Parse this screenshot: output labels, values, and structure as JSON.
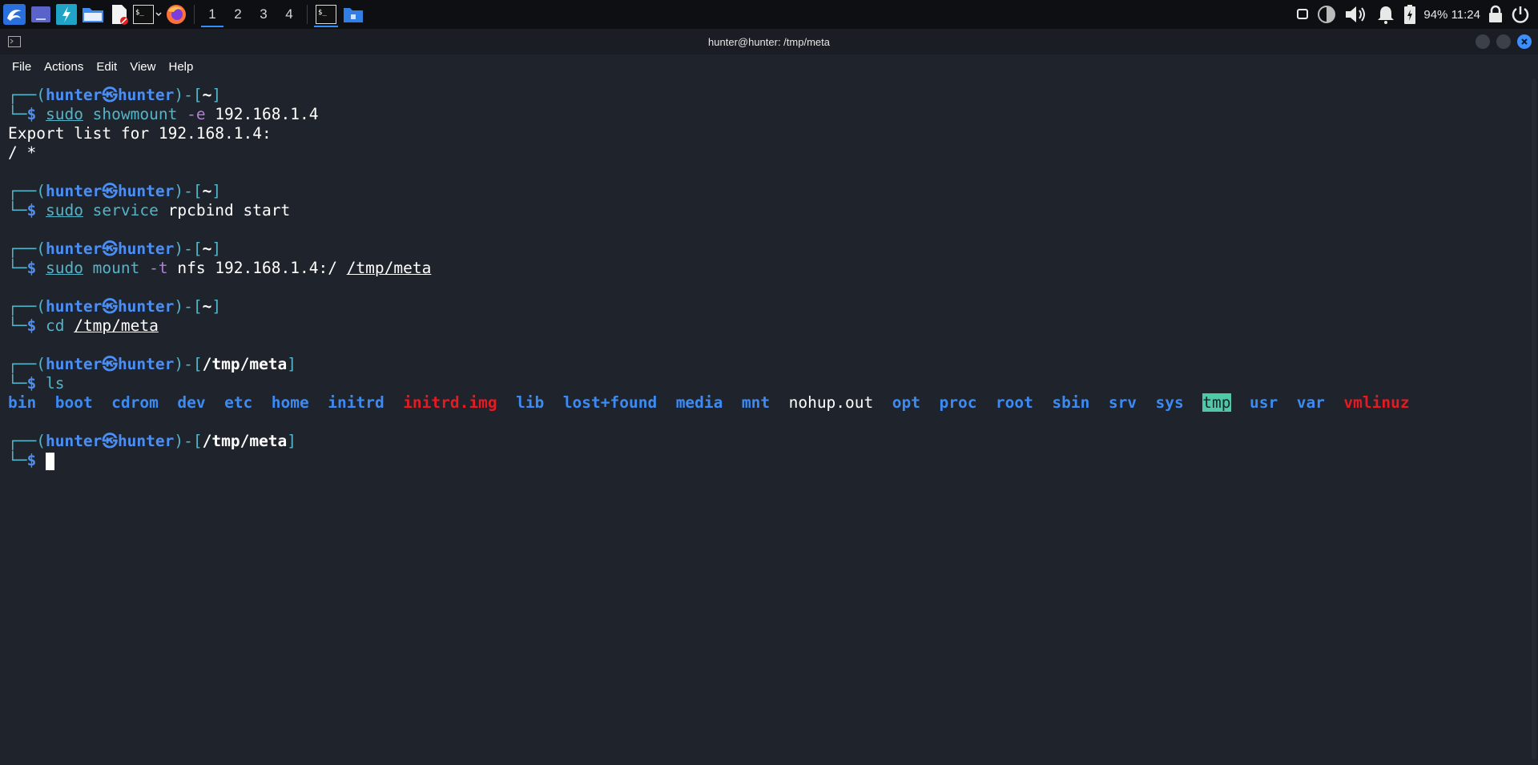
{
  "taskbar": {
    "workspaces": [
      "1",
      "2",
      "3",
      "4"
    ],
    "active_workspace": "1",
    "battery": "94%",
    "time": "11:24",
    "icons": [
      "kali-menu-icon",
      "desktop-icon",
      "settings-icon",
      "file-manager-icon",
      "text-editor-icon",
      "terminal-icon",
      "firefox-icon"
    ]
  },
  "window": {
    "title": "hunter@hunter: /tmp/meta",
    "menu": [
      "File",
      "Actions",
      "Edit",
      "View",
      "Help"
    ]
  },
  "terminal": {
    "user": "hunter",
    "host": "hunter",
    "skull": "㉿",
    "blocks": [
      {
        "path": "~",
        "cmd": "sudo",
        "args": [
          {
            "t": " showmount ",
            "c": "g"
          },
          {
            "t": "-e",
            "c": "opt"
          },
          {
            "t": " 192.168.1.4",
            "c": "plain"
          }
        ]
      },
      {
        "path": "~",
        "cmd": "sudo",
        "args": [
          {
            "t": " service ",
            "c": "g"
          },
          {
            "t": "rpcbind start",
            "c": "plain"
          }
        ]
      },
      {
        "path": "~",
        "cmd": "sudo",
        "args": [
          {
            "t": " mount ",
            "c": "g"
          },
          {
            "t": "-t",
            "c": "opt"
          },
          {
            "t": " nfs 192.168.1.4:/ ",
            "c": "plain"
          },
          {
            "t": "/tmp/meta",
            "c": "ul"
          }
        ]
      },
      {
        "path": "~",
        "cmd": "cd",
        "args": [
          {
            "t": " ",
            "c": "plain"
          },
          {
            "t": "/tmp/meta",
            "c": "ul"
          }
        ]
      },
      {
        "path": "/tmp/meta",
        "cmd": "ls",
        "args": []
      },
      {
        "path": "/tmp/meta",
        "cmd": "",
        "args": []
      }
    ],
    "showmount_output": [
      "Export list for 192.168.1.4:",
      "/ *"
    ],
    "ls_output": [
      {
        "name": "bin",
        "kind": "dir"
      },
      {
        "name": "boot",
        "kind": "dir"
      },
      {
        "name": "cdrom",
        "kind": "dir"
      },
      {
        "name": "dev",
        "kind": "dir"
      },
      {
        "name": "etc",
        "kind": "dir"
      },
      {
        "name": "home",
        "kind": "dir"
      },
      {
        "name": "initrd",
        "kind": "dir"
      },
      {
        "name": "initrd.img",
        "kind": "broken"
      },
      {
        "name": "lib",
        "kind": "dir"
      },
      {
        "name": "lost+found",
        "kind": "dir"
      },
      {
        "name": "media",
        "kind": "dir"
      },
      {
        "name": "mnt",
        "kind": "dir"
      },
      {
        "name": "nohup.out",
        "kind": "file"
      },
      {
        "name": "opt",
        "kind": "dir"
      },
      {
        "name": "proc",
        "kind": "dir"
      },
      {
        "name": "root",
        "kind": "dir"
      },
      {
        "name": "sbin",
        "kind": "dir"
      },
      {
        "name": "srv",
        "kind": "dir"
      },
      {
        "name": "sys",
        "kind": "dir"
      },
      {
        "name": "tmp",
        "kind": "sticky"
      },
      {
        "name": "usr",
        "kind": "dir"
      },
      {
        "name": "var",
        "kind": "dir"
      },
      {
        "name": "vmlinuz",
        "kind": "broken"
      }
    ]
  },
  "colors": {
    "background": "#1f232b",
    "prompt_frame": "#55b4c8",
    "prompt_user": "#4c8ff4",
    "directory": "#3d8bf2",
    "broken_link": "#e31b23",
    "sticky_bg": "#4ec9a6",
    "option": "#b07fd6"
  }
}
